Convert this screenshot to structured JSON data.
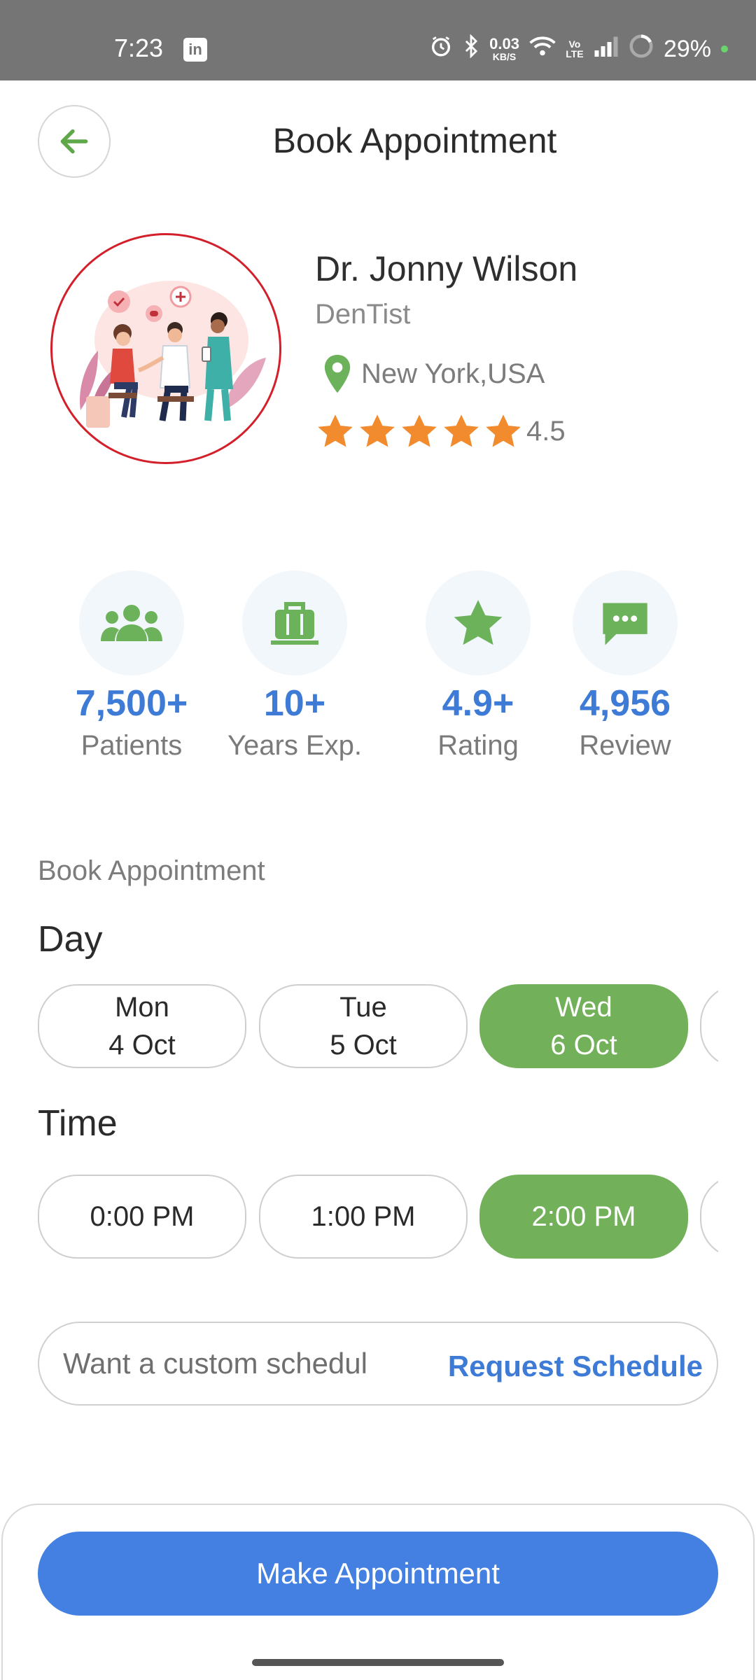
{
  "status_bar": {
    "time": "7:23",
    "app_icon": "linkedin-icon",
    "app_icon_text": "in",
    "net_speed_value": "0.03",
    "net_speed_unit": "KB/S",
    "volte": "Vo LTE",
    "battery": "29%"
  },
  "header": {
    "title": "Book Appointment",
    "back_icon": "arrow-left-icon"
  },
  "doctor": {
    "name": "Dr. Jonny Wilson",
    "specialty": "DenTist",
    "location": "New York,USA",
    "rating": "4.5",
    "stars": 5,
    "star_color": "#f28a2e"
  },
  "stats": [
    {
      "icon": "patients-icon",
      "value": "7,500+",
      "label": "Patients"
    },
    {
      "icon": "briefcase-icon",
      "value": "10+",
      "label": "Years Exp."
    },
    {
      "icon": "star-icon",
      "value": "4.9+",
      "label": "Rating"
    },
    {
      "icon": "chat-icon",
      "value": "4,956",
      "label": "Review"
    }
  ],
  "booking": {
    "section_label": "Book Appointment",
    "day_title": "Day",
    "days": [
      {
        "day": "Mon",
        "date": "4 Oct",
        "selected": false
      },
      {
        "day": "Tue",
        "date": "5 Oct",
        "selected": false
      },
      {
        "day": "Wed",
        "date": "6 Oct",
        "selected": true
      }
    ],
    "time_title": "Time",
    "times": [
      {
        "label": "0:00 PM",
        "selected": false
      },
      {
        "label": "1:00 PM",
        "selected": false
      },
      {
        "label": "2:00 PM",
        "selected": true
      }
    ],
    "custom_placeholder": "Want a custom schedul",
    "request_link": "Request Schedule"
  },
  "footer": {
    "make_button": "Make Appointment"
  },
  "colors": {
    "primary_blue": "#4380e2",
    "stat_blue": "#3d7bd6",
    "green": "#72b15a",
    "avatar_border": "#d31f2a"
  }
}
